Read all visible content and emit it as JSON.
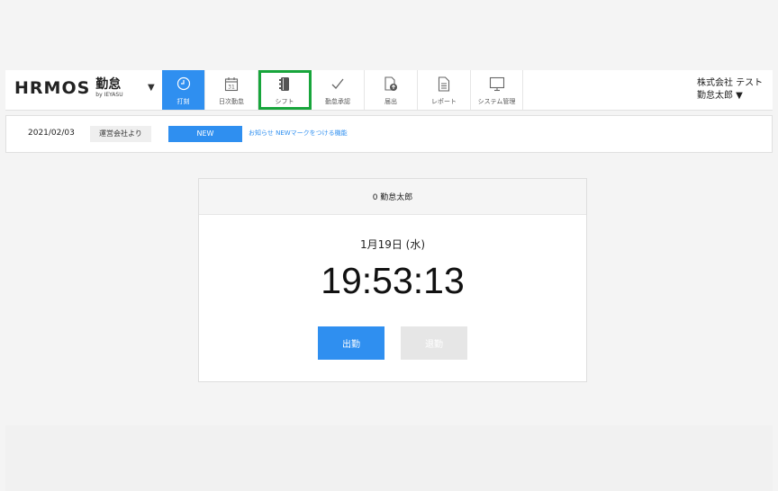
{
  "header": {
    "logo": {
      "main": "HRMOS",
      "sub": "勤怠",
      "by": "by IEYASU"
    },
    "nav": [
      {
        "id": "punch",
        "label": "打刻",
        "icon": "clock-icon",
        "active": true
      },
      {
        "id": "daily",
        "label": "日次勤怠",
        "icon": "calendar-icon"
      },
      {
        "id": "shift",
        "label": "シフト",
        "icon": "notebook-icon"
      },
      {
        "id": "approval",
        "label": "勤怠承認",
        "icon": "checkmark-icon"
      },
      {
        "id": "request",
        "label": "届出",
        "icon": "document-upload-icon"
      },
      {
        "id": "report",
        "label": "レポート",
        "icon": "document-icon"
      },
      {
        "id": "admin",
        "label": "システム管理",
        "icon": "monitor-icon"
      }
    ],
    "company": "株式会社 テスト",
    "user": "勤怠太郎 ▼"
  },
  "notice": {
    "date": "2021/02/03",
    "source": "運営会社より",
    "badge": "NEW",
    "link": "お知らせ NEWマークをつける機能"
  },
  "punch_card": {
    "employee": "0  勤怠太郎",
    "date": "1月19日 (水)",
    "time": "19:53:13",
    "clock_in_label": "出勤",
    "clock_out_label": "退勤"
  },
  "colors": {
    "accent": "#2f8ff0",
    "highlight": "#17a53b",
    "disabled": "#e6e6e6"
  }
}
